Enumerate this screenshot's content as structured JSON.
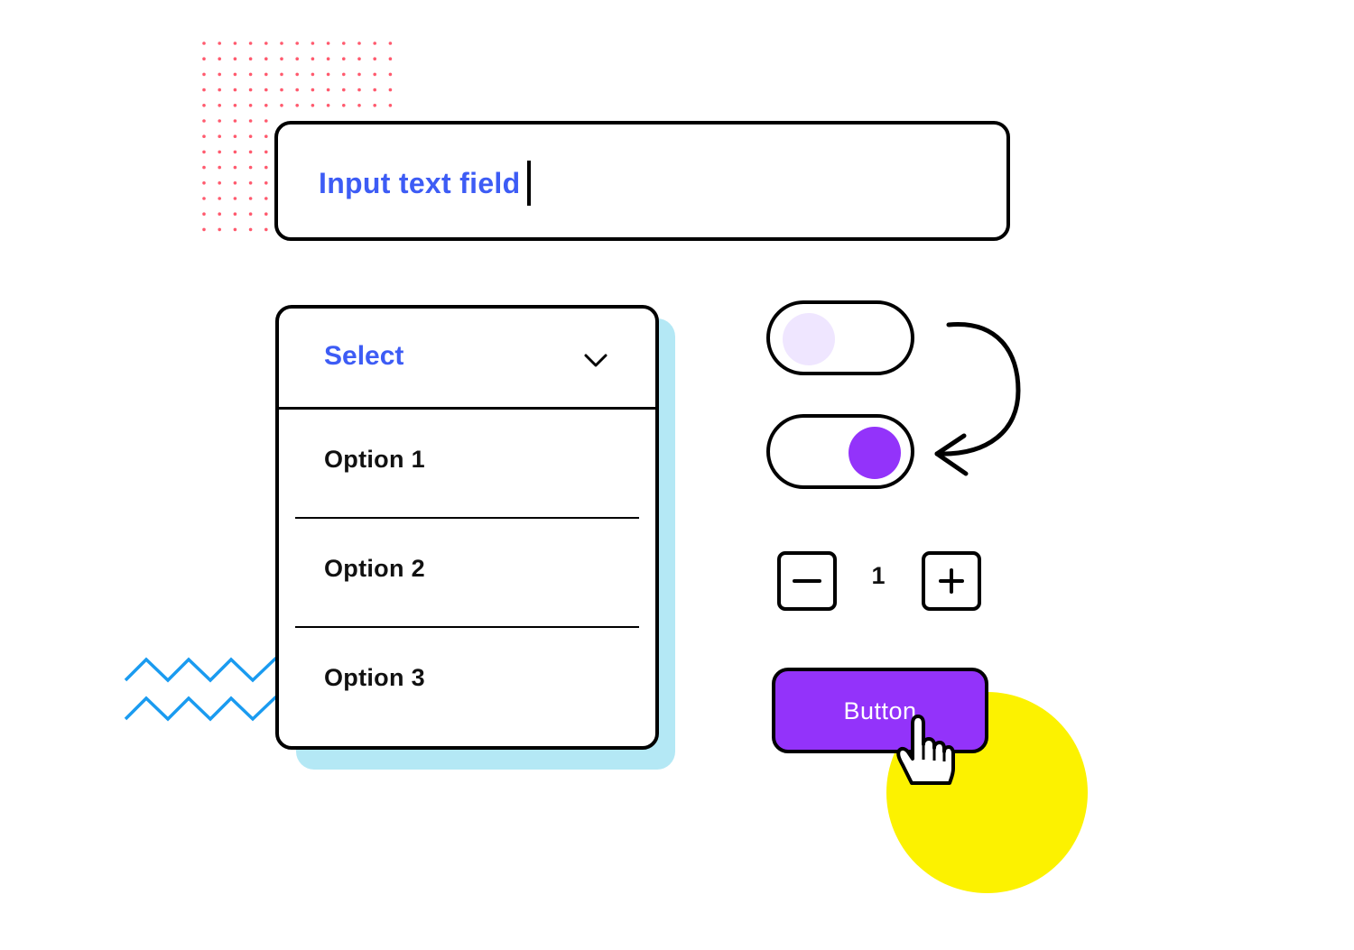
{
  "colors": {
    "accent_blue": "#3d5cf5",
    "purple": "#9333fa",
    "lavender": "#efe6ff",
    "shadow_blue": "#b4e8f5",
    "yellow": "#fcf200",
    "dot_red": "#ff5a6e",
    "zigzag_blue": "#1a9bf0"
  },
  "input": {
    "value": "Input text field",
    "icon": "text-caret"
  },
  "dropdown": {
    "label": "Select",
    "icon": "chevron-down-icon",
    "options": [
      {
        "label": "Option 1"
      },
      {
        "label": "Option 2"
      },
      {
        "label": "Option 3"
      }
    ]
  },
  "toggles": [
    {
      "state": "off"
    },
    {
      "state": "on"
    }
  ],
  "transition_arrow": {
    "icon": "curved-arrow-icon"
  },
  "stepper": {
    "value": "1",
    "decrement_icon": "minus-icon",
    "increment_icon": "plus-icon"
  },
  "button": {
    "label": "Button",
    "cursor_icon": "hand-pointer-icon"
  }
}
